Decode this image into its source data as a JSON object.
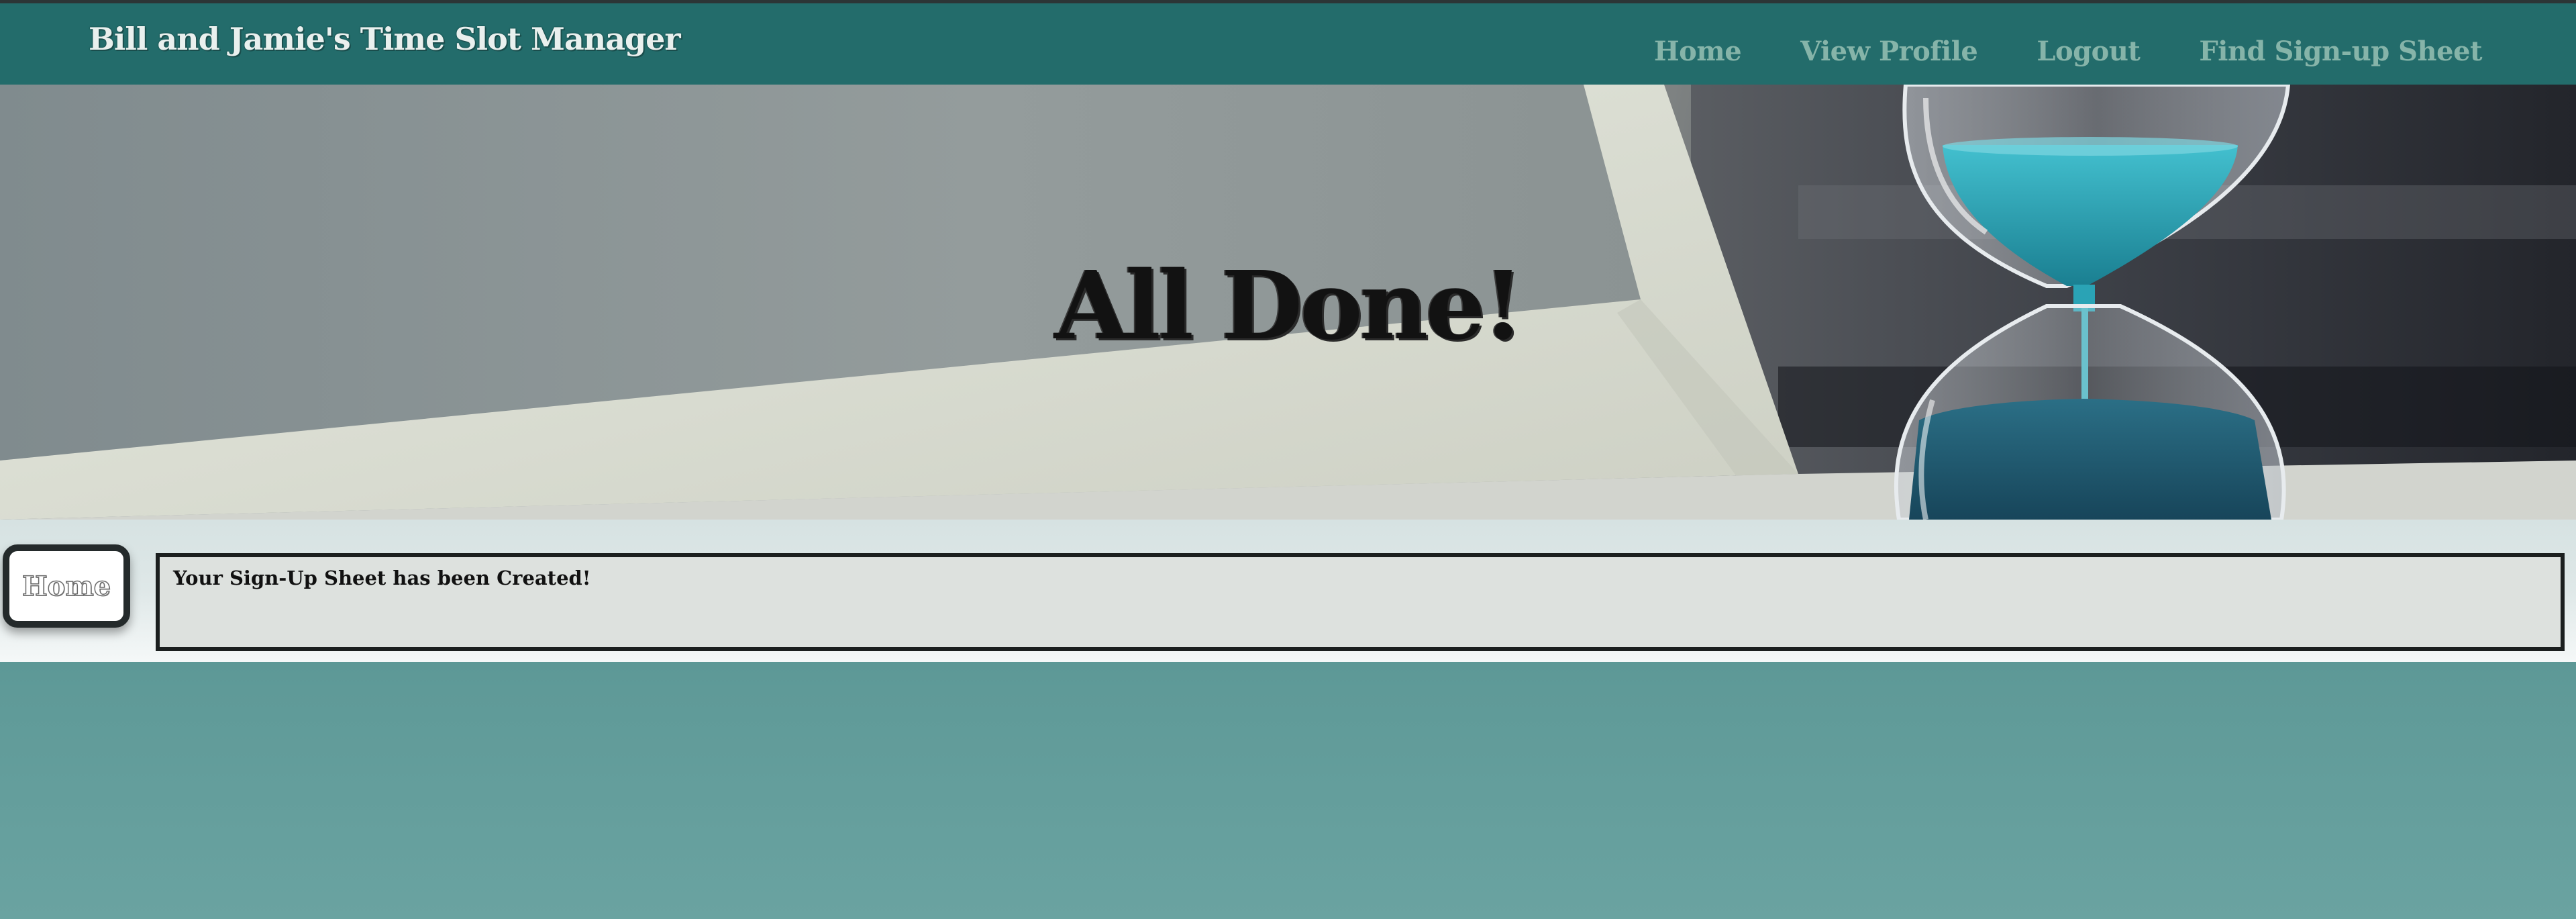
{
  "header": {
    "brand": "Bill and Jamie's Time Slot Manager",
    "nav": [
      {
        "label": "Home"
      },
      {
        "label": "View Profile"
      },
      {
        "label": "Logout"
      },
      {
        "label": "Find Sign-up Sheet"
      }
    ]
  },
  "hero": {
    "title": "All Done!",
    "image": "hourglass-on-desk-photo"
  },
  "content": {
    "home_button": "Home",
    "message": "Your Sign-Up Sheet has been Created!"
  },
  "colors": {
    "nav_bg": "#236c6b",
    "nav_link": "#86b4a9",
    "brand": "#e9f0ee",
    "hourglass_sand": "#2aa3b5"
  }
}
